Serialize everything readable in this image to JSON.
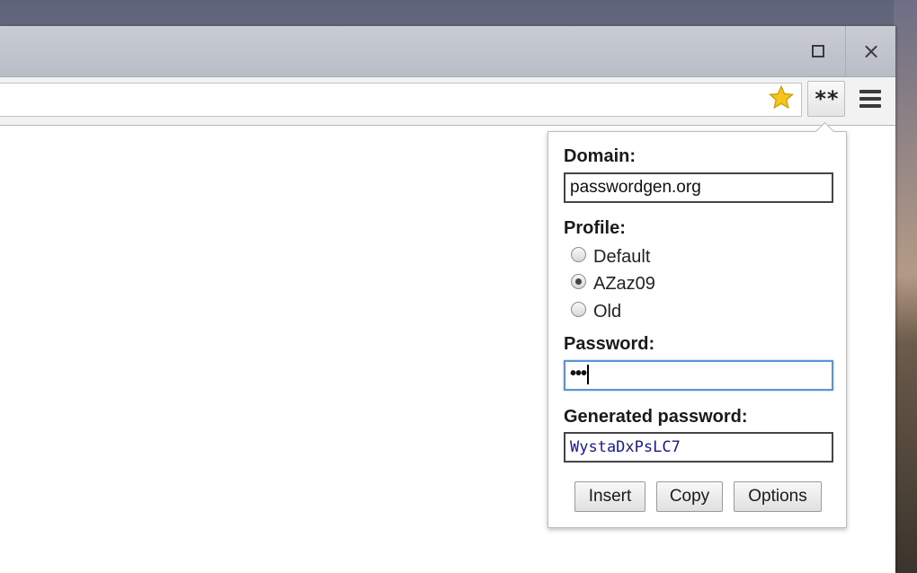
{
  "window": {
    "maximize_glyph": "maximize-icon",
    "close_glyph": "×"
  },
  "toolbar": {
    "extension_label": "**",
    "star_icon": "bookmark-star-icon",
    "menu_icon": "hamburger-menu-icon"
  },
  "popup": {
    "domain_label": "Domain:",
    "domain_value": "passwordgen.org",
    "profile_label": "Profile:",
    "profiles": [
      {
        "label": "Default",
        "checked": false
      },
      {
        "label": "AZaz09",
        "checked": true
      },
      {
        "label": "Old",
        "checked": false
      }
    ],
    "password_label": "Password:",
    "password_masked": "•••",
    "generated_label": "Generated password:",
    "generated_value": "WystaDxPsLC7",
    "buttons": {
      "insert": "Insert",
      "copy": "Copy",
      "options": "Options"
    }
  },
  "colors": {
    "focus_border": "#5b93d6",
    "generated_text": "#1a1a8a",
    "star": "#f5c518"
  }
}
